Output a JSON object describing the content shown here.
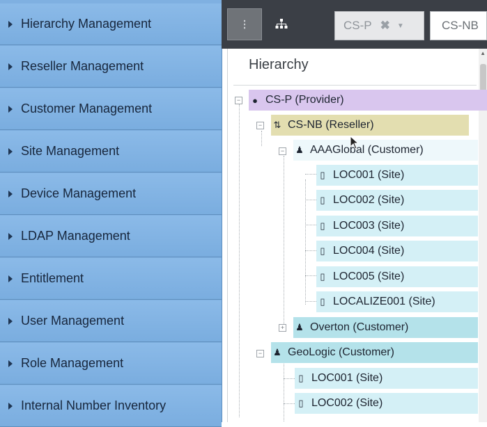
{
  "sidebar": {
    "items": [
      {
        "label": "Hierarchy Management"
      },
      {
        "label": "Reseller Management"
      },
      {
        "label": "Customer Management"
      },
      {
        "label": "Site Management"
      },
      {
        "label": "Device Management"
      },
      {
        "label": "LDAP Management"
      },
      {
        "label": "Entitlement"
      },
      {
        "label": "User Management"
      },
      {
        "label": "Role Management"
      },
      {
        "label": "Internal Number Inventory"
      }
    ]
  },
  "toolbar": {
    "selected_value": "CS-P",
    "clear_symbol": "✖",
    "caret_symbol": "▼",
    "input_value": "CS-NB"
  },
  "panel": {
    "title": "Hierarchy"
  },
  "tree": [
    {
      "label": "CS-P (Provider)",
      "icon": "provider-globe-icon"
    },
    {
      "label": "CS-NB (Reseller)",
      "icon": "reseller-icon"
    },
    {
      "label": "AAAGlobal (Customer)",
      "icon": "customer-group-icon"
    },
    {
      "label": "LOC001 (Site)",
      "icon": "site-building-icon"
    },
    {
      "label": "LOC002 (Site)",
      "icon": "site-building-icon"
    },
    {
      "label": "LOC003 (Site)",
      "icon": "site-building-icon"
    },
    {
      "label": "LOC004 (Site)",
      "icon": "site-building-icon"
    },
    {
      "label": "LOC005 (Site)",
      "icon": "site-building-icon"
    },
    {
      "label": "LOCALIZE001 (Site)",
      "icon": "site-building-icon"
    },
    {
      "label": "Overton (Customer)",
      "icon": "customer-group-icon"
    },
    {
      "label": "GeoLogic (Customer)",
      "icon": "customer-group-icon"
    },
    {
      "label": "LOC001 (Site)",
      "icon": "site-building-icon"
    },
    {
      "label": "LOC002 (Site)",
      "icon": "site-building-icon"
    }
  ],
  "colors": {
    "sidebar": "#7fb0e1",
    "toolbar": "#3b3f46",
    "provider_row": "#d9c6ee",
    "reseller_row": "#e3deb0",
    "customer_row": "#b4e2ea",
    "site_row": "#d4f0f6"
  }
}
